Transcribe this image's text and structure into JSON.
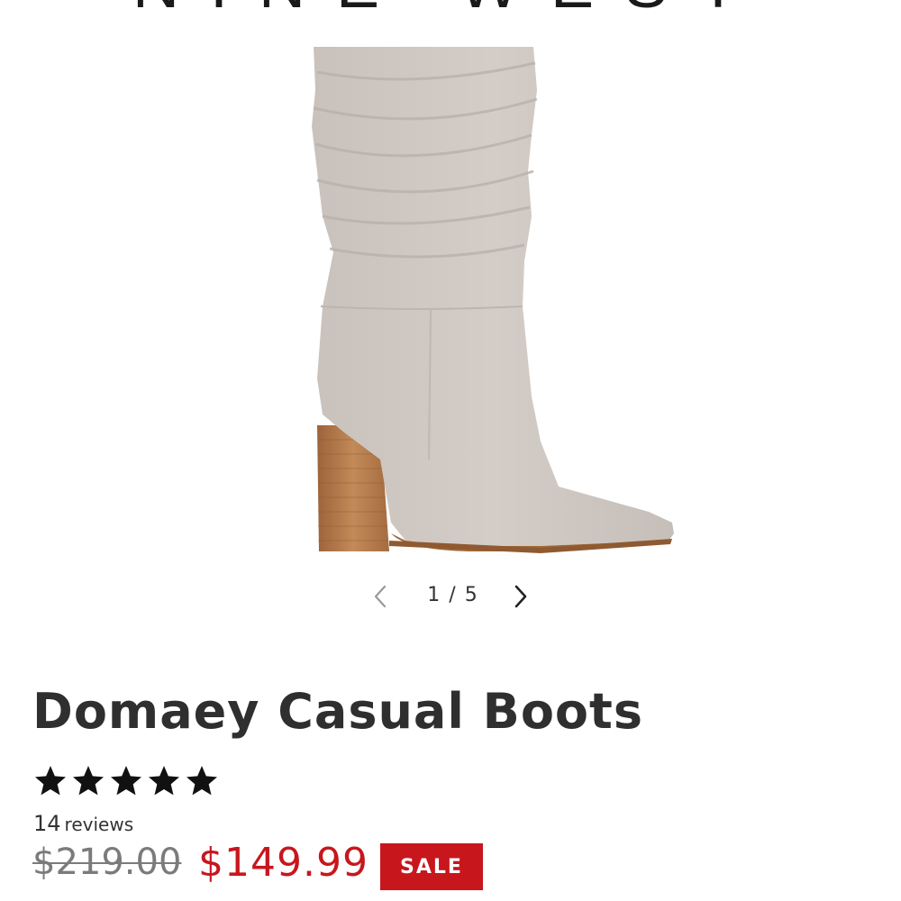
{
  "brand": {
    "name": "NINE WEST"
  },
  "gallery": {
    "image_alt": "Domaey Casual Boots",
    "current": "1",
    "separator": "/",
    "total": "5",
    "prev_icon": "chevron-left-icon",
    "next_icon": "chevron-right-icon"
  },
  "product": {
    "title": "Domaey Casual Boots",
    "rating": 5,
    "rating_max": 5,
    "review_count": "14",
    "review_label": "reviews",
    "original_price": "$219.00",
    "sale_price": "$149.99",
    "badge": "SALE"
  },
  "colors": {
    "sale_red": "#c8161d",
    "boot_suede": "#cdc6c0",
    "heel_wood": "#b37a4c"
  }
}
